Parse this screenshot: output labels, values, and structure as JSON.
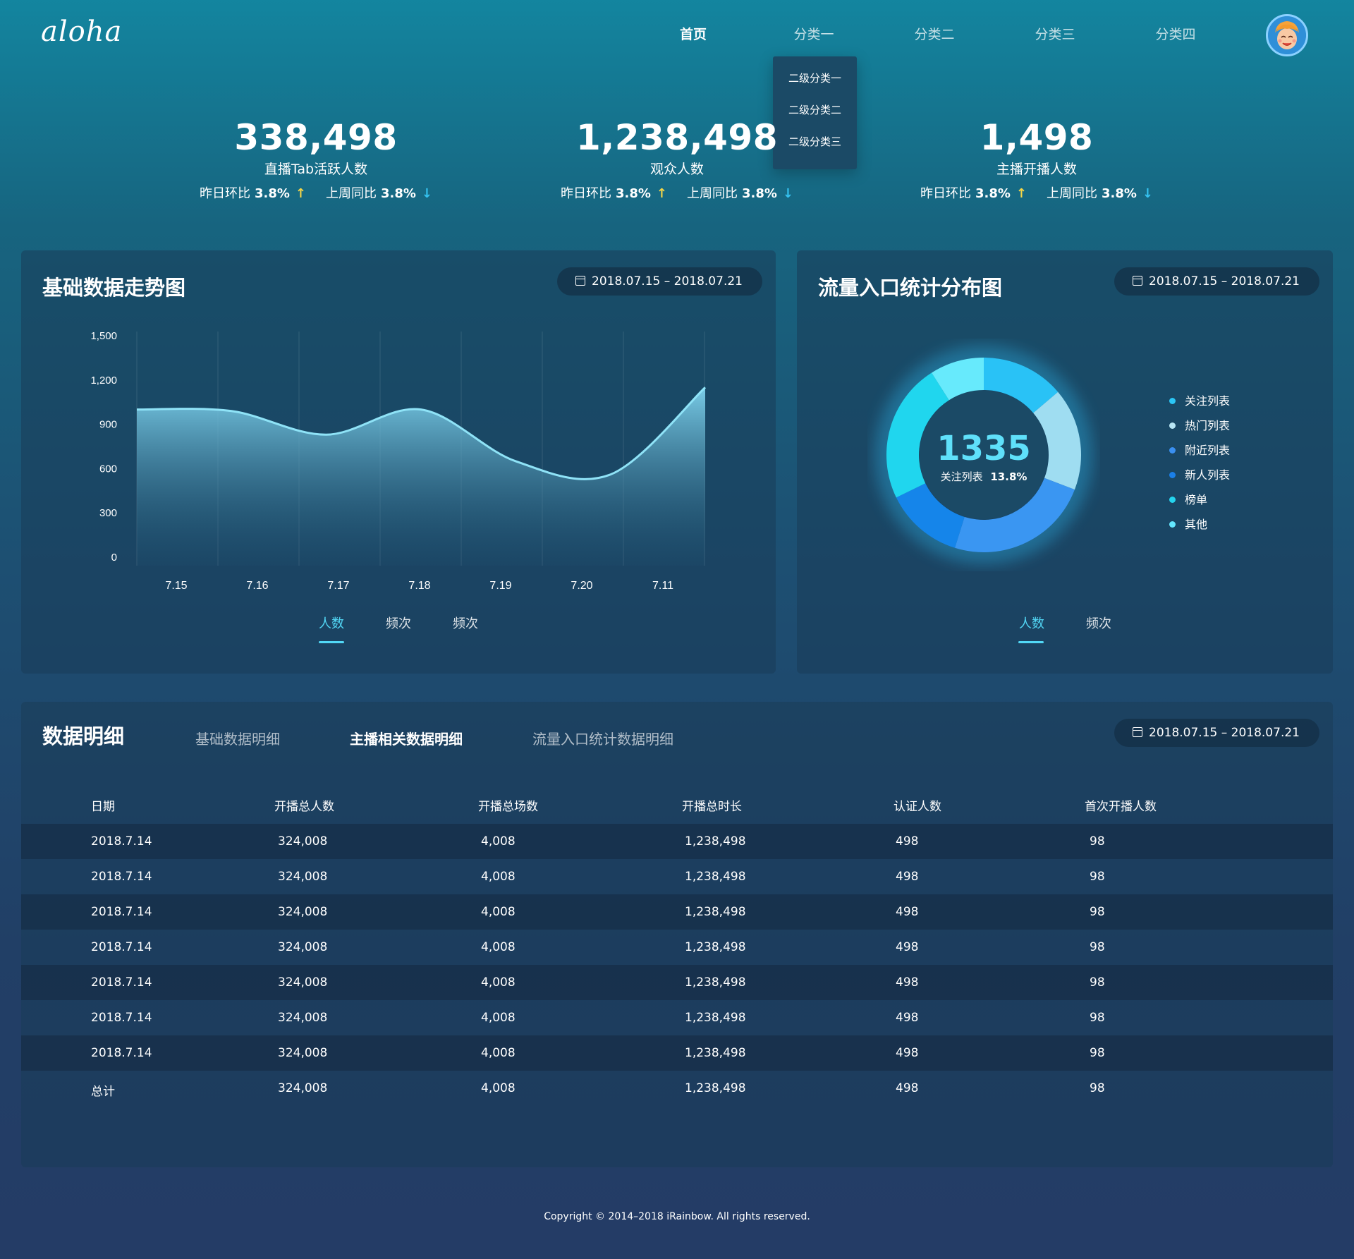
{
  "header": {
    "logo": "aloha",
    "nav": [
      "首页",
      "分类一",
      "分类二",
      "分类三",
      "分类四"
    ],
    "active_nav": "首页",
    "dropdown": [
      "二级分类一",
      "二级分类二",
      "二级分类三"
    ]
  },
  "kpis": [
    {
      "value": "338,498",
      "label": "直播Tab活跃人数",
      "day_label": "昨日环比",
      "day_value": "3.8%",
      "day_dir": "↑",
      "week_label": "上周同比",
      "week_value": "3.8%",
      "week_dir": "↓"
    },
    {
      "value": "1,238,498",
      "label": "观众人数",
      "day_label": "昨日环比",
      "day_value": "3.8%",
      "day_dir": "↑",
      "week_label": "上周同比",
      "week_value": "3.8%",
      "week_dir": "↓"
    },
    {
      "value": "1,498",
      "label": "主播开播人数",
      "day_label": "昨日环比",
      "day_value": "3.8%",
      "day_dir": "↑",
      "week_label": "上周同比",
      "week_value": "3.8%",
      "week_dir": "↓"
    }
  ],
  "trend_panel": {
    "title": "基础数据走势图",
    "date_range": "2018.07.15 – 2018.07.21",
    "tabs": [
      "人数",
      "频次",
      "频次"
    ]
  },
  "traffic_panel": {
    "title": "流量入口统计分布图",
    "date_range": "2018.07.15 – 2018.07.21",
    "center_value": "1335",
    "center_label": "关注列表",
    "center_percent": "13.8%",
    "tabs": [
      "人数",
      "频次"
    ]
  },
  "detail_panel": {
    "title": "数据明细",
    "tabs": [
      "基础数据明细",
      "主播相关数据明细",
      "流量入口统计数据明细"
    ],
    "active_tab": "主播相关数据明细",
    "date_range": "2018.07.15 – 2018.07.21",
    "columns": [
      "日期",
      "开播总人数",
      "开播总场数",
      "开播总时长",
      "认证人数",
      "首次开播人数"
    ],
    "rows": [
      [
        "2018.7.14",
        "324,008",
        "4,008",
        "1,238,498",
        "498",
        "98"
      ],
      [
        "2018.7.14",
        "324,008",
        "4,008",
        "1,238,498",
        "498",
        "98"
      ],
      [
        "2018.7.14",
        "324,008",
        "4,008",
        "1,238,498",
        "498",
        "98"
      ],
      [
        "2018.7.14",
        "324,008",
        "4,008",
        "1,238,498",
        "498",
        "98"
      ],
      [
        "2018.7.14",
        "324,008",
        "4,008",
        "1,238,498",
        "498",
        "98"
      ],
      [
        "2018.7.14",
        "324,008",
        "4,008",
        "1,238,498",
        "498",
        "98"
      ],
      [
        "2018.7.14",
        "324,008",
        "4,008",
        "1,238,498",
        "498",
        "98"
      ],
      [
        "总计",
        "324,008",
        "4,008",
        "1,238,498",
        "498",
        "98"
      ]
    ]
  },
  "footer": "Copyright © 2014–2018 iRainbow. All rights reserved.",
  "colors": {
    "accent": "#52d8f6",
    "up": "#f5d547",
    "down": "#35c3f2",
    "area_line": "#8fe3f7"
  },
  "chart_data": [
    {
      "type": "area",
      "categories": [
        "7.15",
        "7.16",
        "7.17",
        "7.18",
        "7.19",
        "7.20",
        "7.11"
      ],
      "yticks": [
        "1,500",
        "1,200",
        "900",
        "600",
        "300",
        "0"
      ],
      "ylim": [
        0,
        1500
      ],
      "series": [
        {
          "values": [
            1000,
            990,
            830,
            1000,
            650,
            560,
            1150
          ]
        }
      ],
      "grid": "vertical"
    },
    {
      "type": "pie",
      "categories": [
        "关注列表",
        "热门列表",
        "附近列表",
        "新人列表",
        "榜单",
        "其他"
      ],
      "legend_colors": [
        "#2bc6f5",
        "#b8e6f5",
        "#3a8ff0",
        "#1a7fe8",
        "#24d4ee",
        "#64e7ff"
      ],
      "segment_colors": [
        "#29c2f6",
        "#9fddf1",
        "#3a96f2",
        "#1585ea",
        "#20d6ee",
        "#67eafc"
      ],
      "values": [
        13.8,
        17.0,
        24.0,
        13.0,
        23.2,
        9.0
      ]
    }
  ]
}
